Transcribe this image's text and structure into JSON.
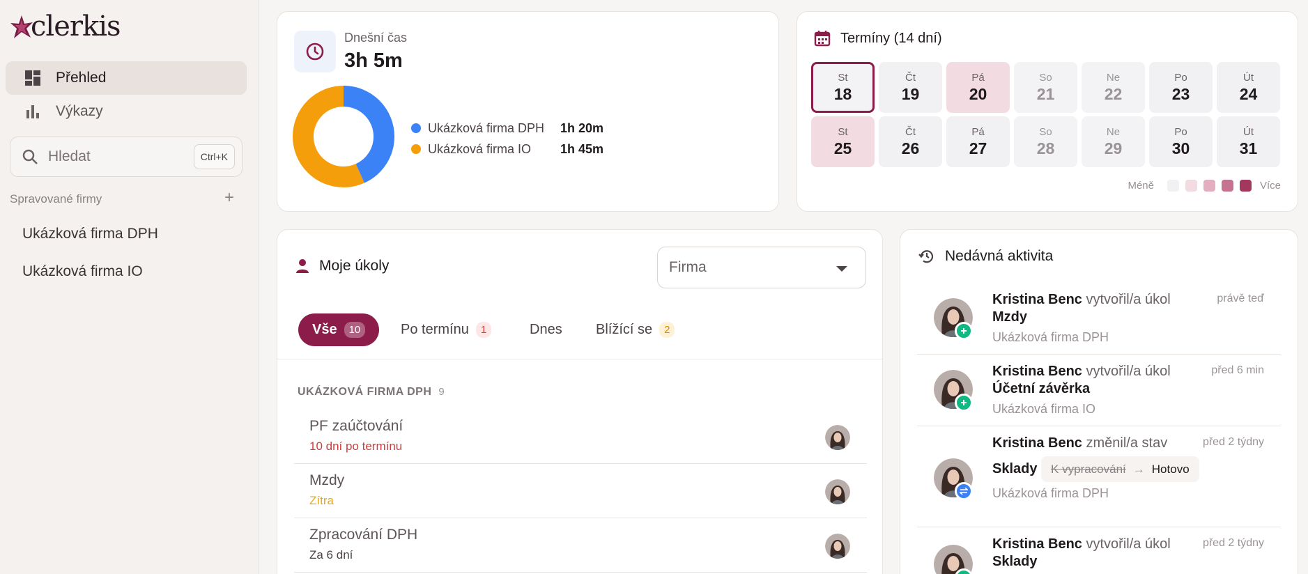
{
  "app": {
    "logo_text": "clerkis"
  },
  "sidebar": {
    "nav": [
      {
        "label": "Přehled",
        "icon": "dashboard-icon",
        "active": true
      },
      {
        "label": "Výkazy",
        "icon": "bar-chart-icon",
        "active": false
      }
    ],
    "search": {
      "placeholder": "Hledat",
      "shortcut": "Ctrl+K"
    },
    "section_title": "Spravované firmy",
    "add_label": "+",
    "firms": [
      "Ukázková firma DPH",
      "Ukázková firma IO"
    ]
  },
  "today_time": {
    "label": "Dnešní čas",
    "value": "3h 5m",
    "entries": [
      {
        "name": "Ukázková firma DPH",
        "value": "1h 20m",
        "minutes": 80,
        "color": "#3b82f6"
      },
      {
        "name": "Ukázková firma IO",
        "value": "1h 45m",
        "minutes": 105,
        "color": "#f59e0b"
      }
    ]
  },
  "deadlines": {
    "title": "Termíny (14 dní)",
    "days": [
      {
        "dow": "St",
        "day": "18",
        "state": "today"
      },
      {
        "dow": "Čt",
        "day": "19",
        "state": "normal"
      },
      {
        "dow": "Pá",
        "day": "20",
        "state": "busy"
      },
      {
        "dow": "So",
        "day": "21",
        "state": "weekend"
      },
      {
        "dow": "Ne",
        "day": "22",
        "state": "weekend"
      },
      {
        "dow": "Po",
        "day": "23",
        "state": "normal"
      },
      {
        "dow": "Út",
        "day": "24",
        "state": "normal"
      },
      {
        "dow": "St",
        "day": "25",
        "state": "busy"
      },
      {
        "dow": "Čt",
        "day": "26",
        "state": "normal"
      },
      {
        "dow": "Pá",
        "day": "27",
        "state": "normal"
      },
      {
        "dow": "So",
        "day": "28",
        "state": "weekend"
      },
      {
        "dow": "Ne",
        "day": "29",
        "state": "weekend"
      },
      {
        "dow": "Po",
        "day": "30",
        "state": "normal"
      },
      {
        "dow": "Út",
        "day": "31",
        "state": "normal"
      }
    ],
    "scale_less": "Méně",
    "scale_more": "Více",
    "scale_colors": [
      "#f1f1f3",
      "#f2dce2",
      "#e2aec0",
      "#c57391",
      "#a3385f"
    ]
  },
  "tasks": {
    "title": "Moje úkoly",
    "filter": {
      "value": "Firma"
    },
    "tabs": [
      {
        "label": "Vše",
        "count": "10",
        "active": true
      },
      {
        "label": "Po termínu",
        "count": "1",
        "badge": "red"
      },
      {
        "label": "Dnes",
        "count": ""
      },
      {
        "label": "Blížící se",
        "count": "2",
        "badge": "orange"
      }
    ],
    "group": {
      "name": "UKÁZKOVÁ FIRMA DPH",
      "count": "9"
    },
    "items": [
      {
        "name": "PF zaúčtování",
        "due": "10 dní po termínu",
        "due_color": "#d23b3b"
      },
      {
        "name": "Mzdy",
        "due": "Zítra",
        "due_color": "#e6a817"
      },
      {
        "name": "Zpracování DPH",
        "due": "Za 6 dní",
        "due_color": "#4b4346"
      }
    ]
  },
  "activity": {
    "title": "Nedávná aktivita",
    "items": [
      {
        "user": "Kristina Benc",
        "action": " vytvořil/a úkol ",
        "target": "Mzdy",
        "firm": "Ukázková firma DPH",
        "time": "právě teď",
        "status": "created"
      },
      {
        "user": "Kristina Benc",
        "action": " vytvořil/a úkol ",
        "target": "Účetní závěrka",
        "firm": "Ukázková firma IO",
        "time": "před 6 min",
        "status": "created"
      },
      {
        "user": "Kristina Benc",
        "action": " změnil/a stav ",
        "target": "Sklady",
        "from_state": "K vypracování",
        "to_state": "Hotovo",
        "firm": "Ukázková firma DPH",
        "time": "před 2 týdny",
        "status": "changed"
      },
      {
        "user": "Kristina Benc",
        "action": " vytvořil/a úkol ",
        "target": "Sklady",
        "firm": "",
        "time": "před 2 týdny",
        "status": "created"
      }
    ]
  }
}
